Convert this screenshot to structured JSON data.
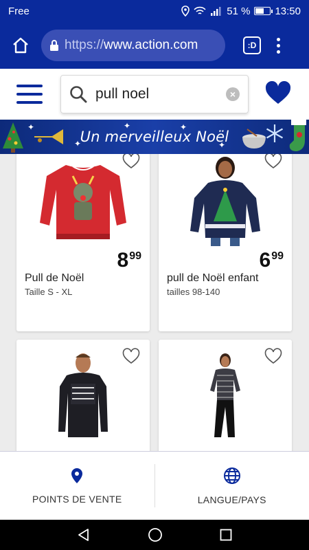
{
  "status": {
    "carrier": "Free",
    "battery": "51 %",
    "battery_level": 0.51,
    "time": "13:50"
  },
  "browser": {
    "url_scheme": "https://",
    "url_host": "www.action.com",
    "tab_label": ":D"
  },
  "search": {
    "value": "pull noel"
  },
  "banner": {
    "text": "Un merveilleux Noël"
  },
  "products": [
    {
      "price_int": "8",
      "price_cents": "99",
      "name": "Pull de Noël",
      "subtitle": "Taille S - XL"
    },
    {
      "price_int": "6",
      "price_cents": "99",
      "name": "pull de Noël enfant",
      "subtitle": "tailles 98-140"
    },
    {
      "price_int": "",
      "price_cents": "",
      "name": "",
      "subtitle": ""
    },
    {
      "price_int": "",
      "price_cents": "",
      "name": "",
      "subtitle": ""
    }
  ],
  "bottom_nav": {
    "stores": "POINTS DE VENTE",
    "language": "LANGUE/PAYS"
  },
  "colors": {
    "brand_blue": "#0a2a9c",
    "sweater_red": "#d42a30",
    "sweater_navy": "#1f2b52"
  }
}
